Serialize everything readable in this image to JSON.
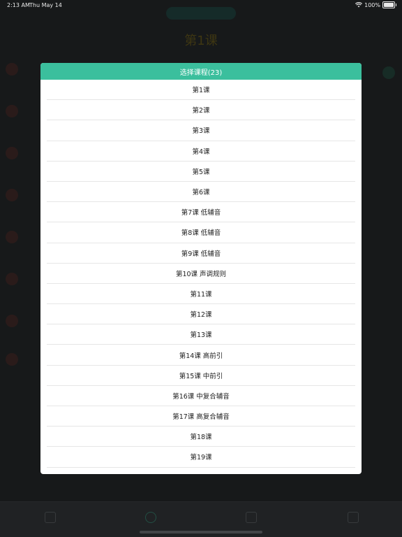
{
  "status_bar": {
    "time": "2:13 AM",
    "date": "Thu May 14",
    "battery": "100%",
    "battery_level": 1.0
  },
  "background": {
    "title": "第1课"
  },
  "dialog": {
    "title": "选择课程(23)",
    "courses": [
      "第1课",
      "第2课",
      "第3课",
      "第4课",
      "第5课",
      "第6课",
      "第7课 低辅音",
      "第8课 低辅音",
      "第9课 低辅音",
      "第10课 声调规则",
      "第11课",
      "第12课",
      "第13课",
      "第14课 高前引",
      "第15课 中前引",
      "第16课 中复合辅音",
      "第17课 高复合辅音",
      "第18课",
      "第19课"
    ]
  },
  "colors": {
    "accent": "#3bbf9d",
    "background": "#1f2223",
    "dialog": "#ffffff"
  }
}
